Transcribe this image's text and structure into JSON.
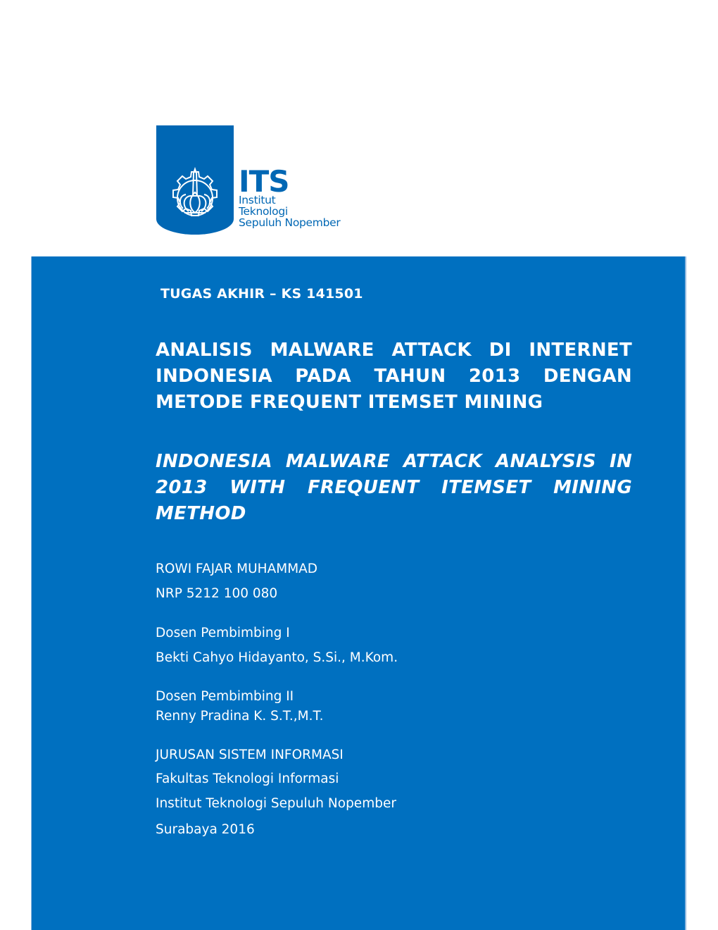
{
  "logo": {
    "icon": "its-emblem-icon",
    "acronym": "ITS",
    "line1": "Institut",
    "line2": "Teknologi",
    "line3": "Sepuluh Nopember"
  },
  "cover": {
    "document_code": "TUGAS AKHIR – KS 141501",
    "title_indonesian": "ANALISIS MALWARE ATTACK DI INTERNET INDONESIA PADA TAHUN 2013 DENGAN METODE FREQUENT ITEMSET MINING",
    "title_english": "INDONESIA MALWARE ATTACK ANALYSIS IN 2013 WITH FREQUENT ITEMSET MINING METHOD",
    "author_name": "ROWI FAJAR MUHAMMAD",
    "author_nrp": "NRP 5212 100 080",
    "advisor1_label": "Dosen Pembimbing I",
    "advisor1_name": "Bekti Cahyo Hidayanto, S.Si., M.Kom.",
    "advisor2_label": "Dosen Pembimbing II",
    "advisor2_name": "Renny Pradina K. S.T.,M.T.",
    "department": "JURUSAN SISTEM INFORMASI",
    "faculty": "Fakultas Teknologi Informasi",
    "institute": "Institut Teknologi Sepuluh Nopember",
    "city_year": "Surabaya 2016"
  },
  "colors": {
    "brand_blue": "#0070c0",
    "logo_blue": "#0067b4",
    "text": "#ffffff"
  }
}
